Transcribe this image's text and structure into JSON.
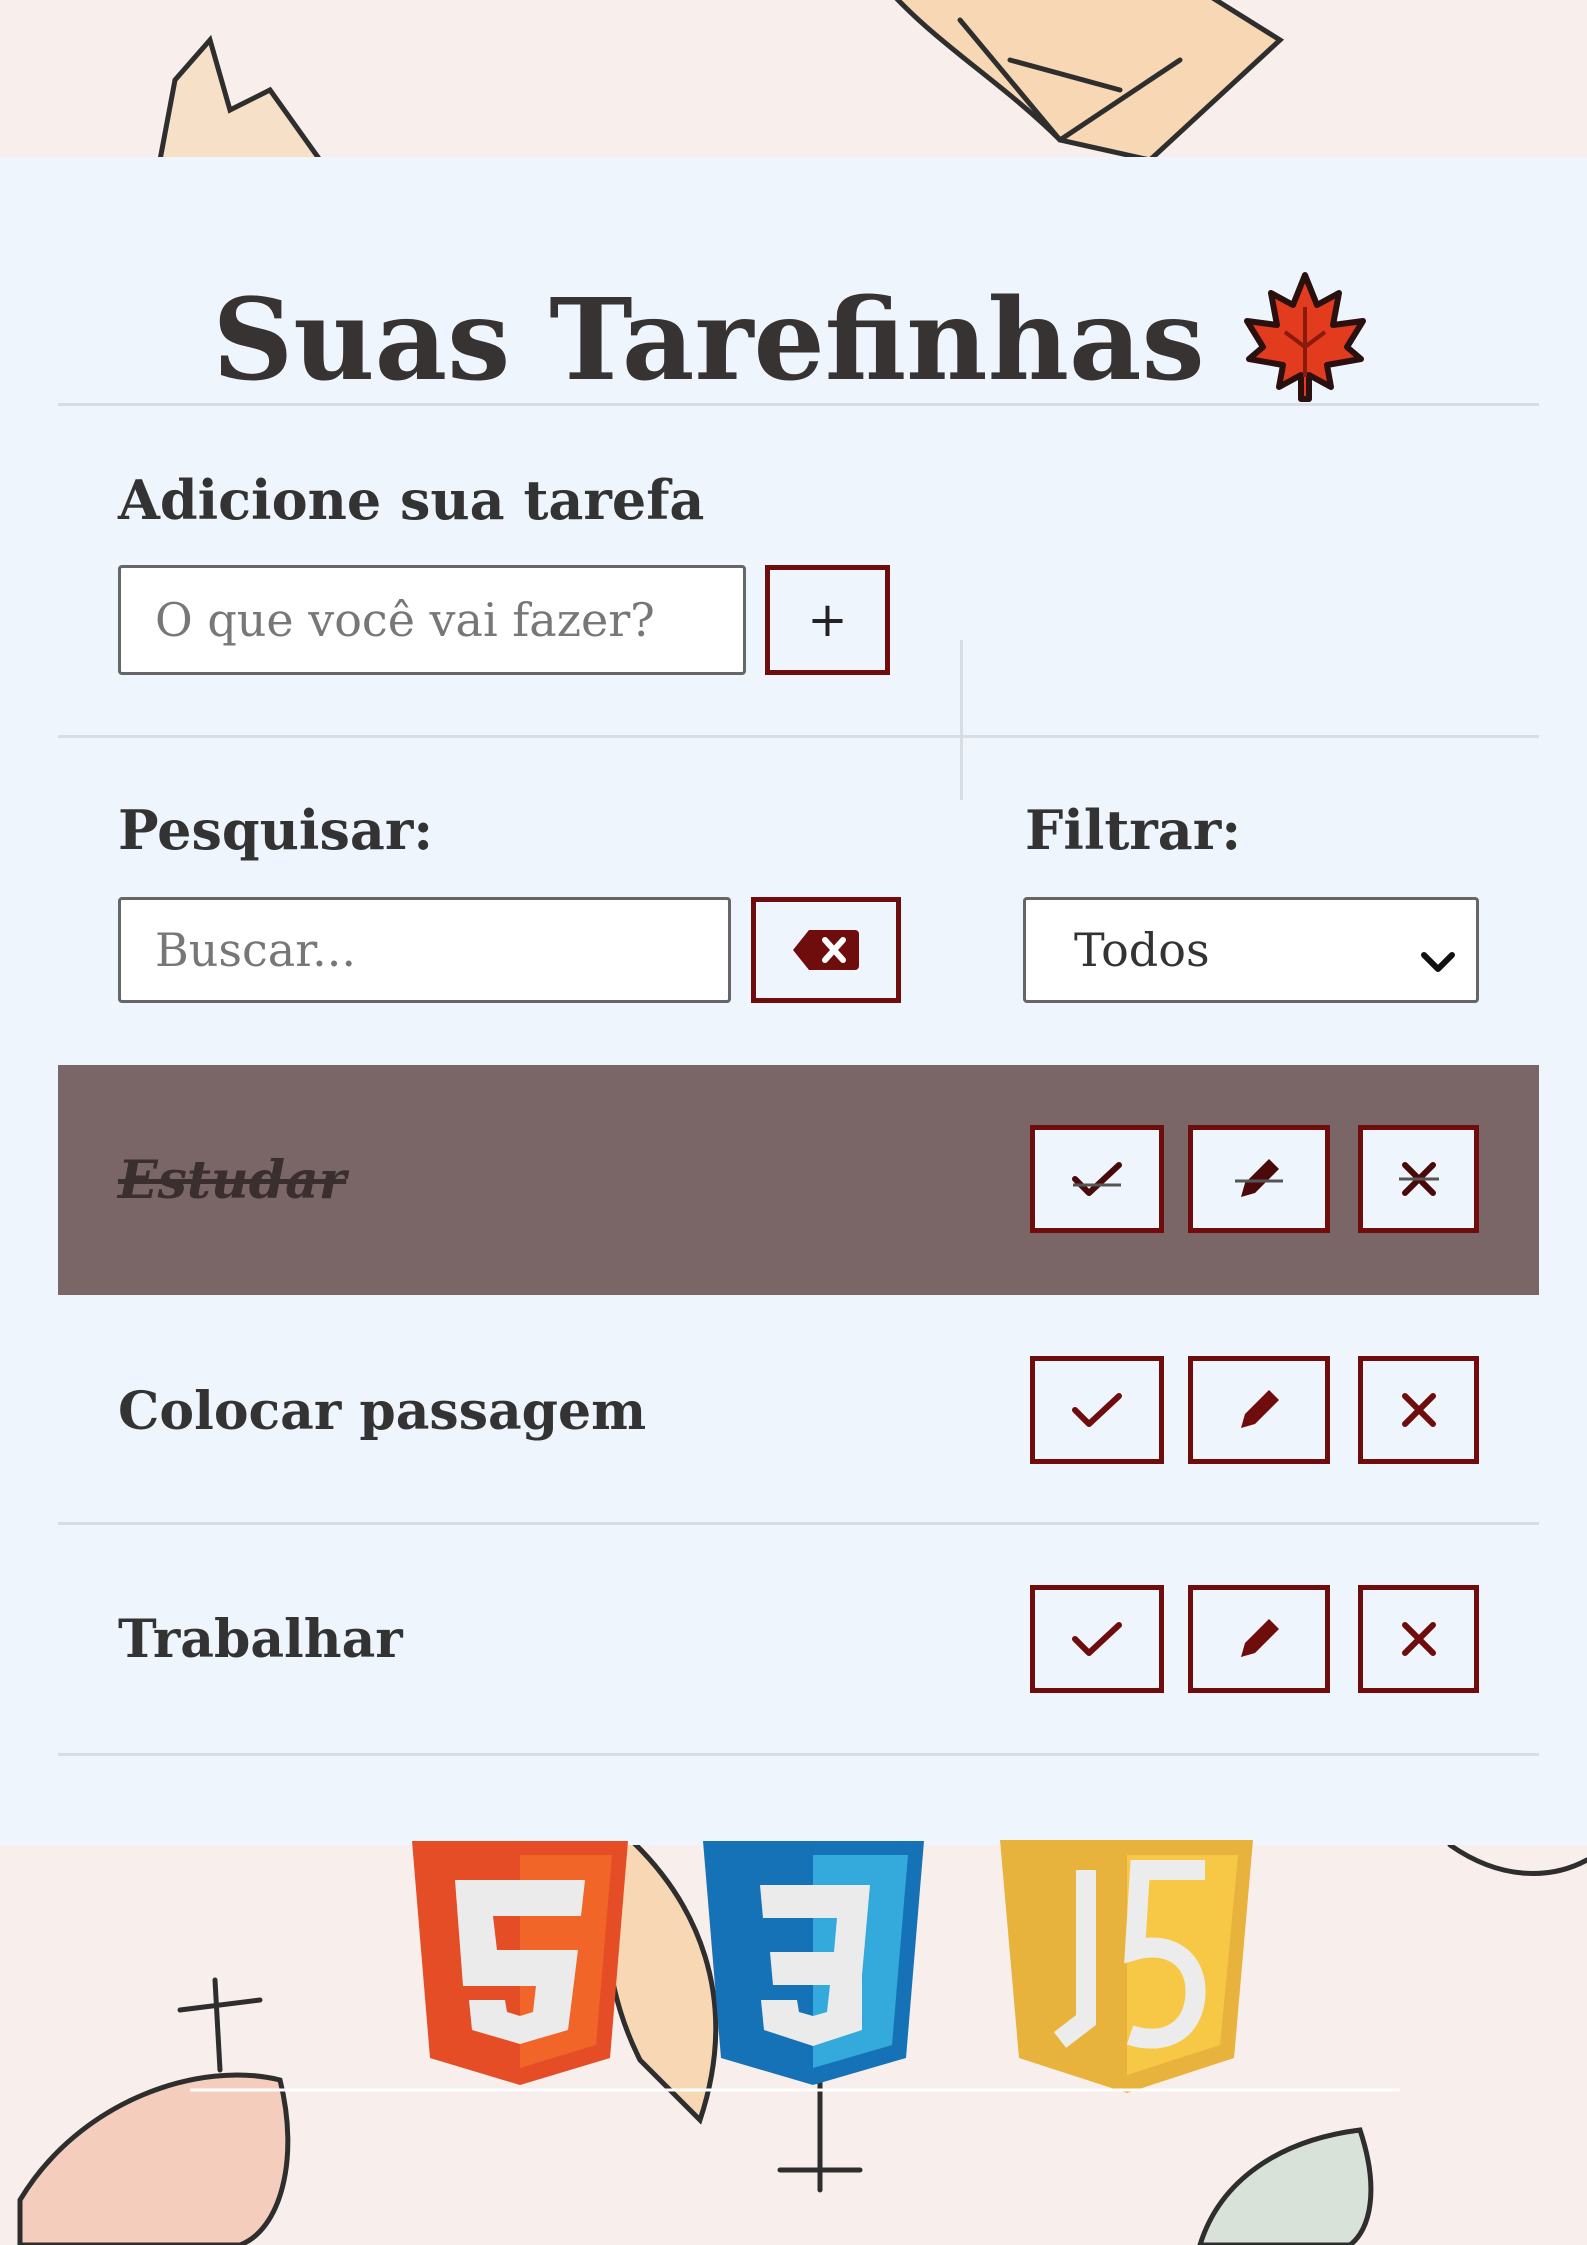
{
  "title": "Suas Tarefinhas",
  "add": {
    "label": "Adicione sua tarefa",
    "placeholder": "O que você vai fazer?",
    "button_label": "+"
  },
  "search": {
    "label": "Pesquisar:",
    "placeholder": "Buscar..."
  },
  "filter": {
    "label": "Filtrar:",
    "selected": "Todos"
  },
  "todos": [
    {
      "text": "Estudar",
      "done": true
    },
    {
      "text": "Colocar passagem",
      "done": false
    },
    {
      "text": "Trabalhar",
      "done": false
    }
  ],
  "icons": {
    "title_icon": "maple-leaf-icon",
    "add": "plus-icon",
    "clear_search": "backspace-icon",
    "filter_dropdown": "chevron-down-icon",
    "finish": "check-icon",
    "edit": "pencil-icon",
    "remove": "close-icon",
    "footer": [
      "html5-logo",
      "css3-logo",
      "javascript-logo"
    ]
  },
  "colors": {
    "accent": "#6f0d0d",
    "card_background": "#eff5fc",
    "done_row": "#7a6666",
    "page_background": "#f8efec"
  }
}
